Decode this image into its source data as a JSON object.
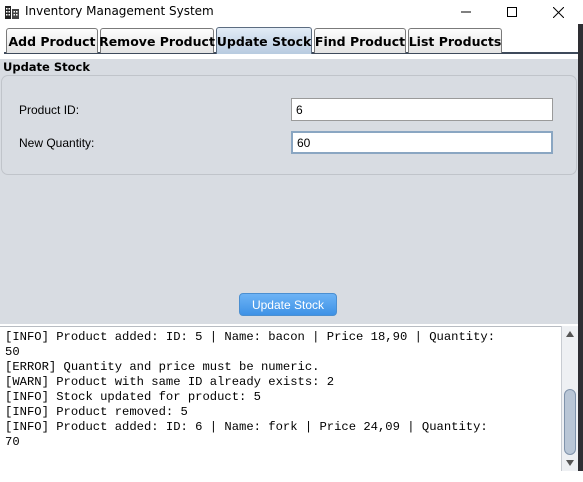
{
  "window": {
    "title": "Inventory Management System",
    "icon": "building-app-icon"
  },
  "tabs": [
    {
      "label": "Add Product",
      "active": false
    },
    {
      "label": "Remove Product",
      "active": false
    },
    {
      "label": "Update Stock",
      "active": true
    },
    {
      "label": "Find Product",
      "active": false
    },
    {
      "label": "List Products",
      "active": false
    }
  ],
  "panel": {
    "section_title": "Update Stock",
    "product_id_label": "Product ID:",
    "product_id_value": "6",
    "new_quantity_label": "New Quantity:",
    "new_quantity_value": "60",
    "update_button_label": "Update Stock"
  },
  "log": [
    "[INFO] Product added: ID: 5 | Name: bacon | Price 18,90 | Quantity:",
    "50",
    "[ERROR] Quantity and price must be numeric.",
    "[WARN] Product with same ID already exists: 2",
    "[INFO] Stock updated for product: 5",
    "[INFO] Product removed: 5",
    "[INFO] Product added: ID: 6 | Name: fork | Price 24,09 | Quantity:",
    "70"
  ],
  "colors": {
    "panel_bg": "#d8dce2",
    "active_tab": "#b8cbe0",
    "button_accent": "#3e92e6"
  }
}
